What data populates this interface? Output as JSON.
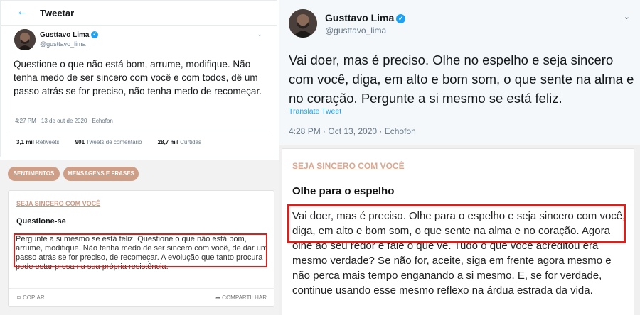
{
  "tweet_left": {
    "header_title": "Tweetar",
    "back_icon": "arrow-left-icon",
    "name": "Gusttavo Lima",
    "handle": "@gusttavo_lima",
    "text": "Questione o que não está bom, arrume, modifique. Não tenha medo de ser sincero com você e com todos, dê um passo atrás se for preciso, não tenha medo de recomeçar.",
    "meta": "4:27 PM · 13 de out de 2020 · Echofon",
    "stats": {
      "retweets_count": "3,1 mil",
      "retweets_label": "Retweets",
      "comments_count": "901",
      "comments_label": "Tweets de comentário",
      "likes_count": "28,7 mil",
      "likes_label": "Curtidas"
    }
  },
  "tweet_right": {
    "name": "Gusttavo Lima",
    "handle": "@gusttavo_lima",
    "text": "Vai doer, mas é preciso. Olhe no espelho e seja sincero com você, diga, em alto e bom som, o que sente na alma e no coração. Pergunte a si mesmo se está feliz.",
    "translate": "Translate Tweet",
    "meta": "4:28 PM · Oct 13, 2020 · Echofon"
  },
  "card_left": {
    "tags": [
      "SENTIMENTOS",
      "MENSAGENS E FRASES"
    ],
    "category": "SEJA SINCERO COM VOCÊ",
    "title": "Questione-se",
    "text": "Pergunte a si mesmo se está feliz. Questione o que não está bom, arrume, modifique. Não tenha medo de ser sincero com você, de dar um passo atrás se for preciso, de recomeçar. A evolução que tanto procura pode estar presa na sua própria resistência.",
    "copy_label": "COPIAR",
    "share_label": "COMPARTILHAR"
  },
  "card_right": {
    "category": "SEJA SINCERO COM VOCÊ",
    "title": "Olhe para o espelho",
    "text": "Vai doer, mas é preciso. Olhe para o espelho e seja sincero com você, diga, em alto e bom som, o que sente na alma e no coração. Agora olhe ao seu redor e fale o que vê. Tudo o que você acreditou era mesmo verdade? Se não for, aceite, siga em frente agora mesmo e não perca mais tempo enganando a si mesmo. E, se for verdade, continue usando esse mesmo reflexo na árdua estrada da vida."
  },
  "colors": {
    "twitter_blue": "#1da1f2",
    "highlight_red": "#d9201c",
    "tag_background": "#cf9e86",
    "category_text": "#c89a85"
  }
}
